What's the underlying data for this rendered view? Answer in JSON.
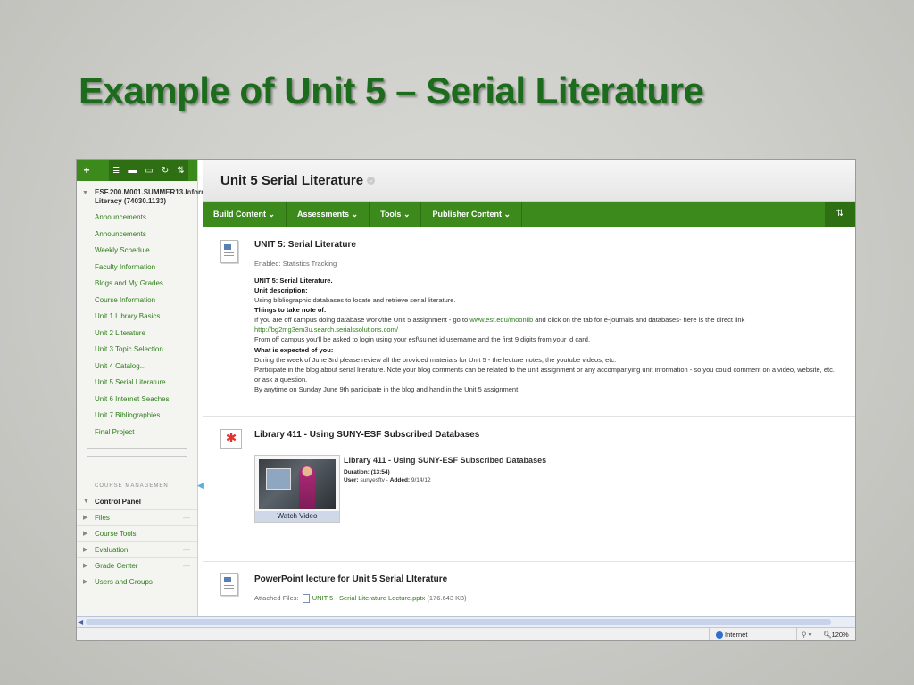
{
  "slide": {
    "title": "Example of Unit 5 – Serial Literature"
  },
  "sidebar": {
    "toolbar": {
      "add": "+",
      "icons": [
        "≣",
        "▬",
        "▭",
        "↻",
        "⇅"
      ]
    },
    "course_title": "ESF.200.M001.SUMMER13.Information Literacy (74030.1133)",
    "items": [
      "Announcements",
      "Announcements",
      "Weekly Schedule",
      "Faculty Information",
      "Blogs and My Grades",
      "Course Information",
      "Unit 1 Library Basics",
      "Unit 2 Literature",
      "Unit 3 Topic Selection",
      "Unit 4 Catalog...",
      "Unit 5 Serial Literature",
      "Unit 6 Internet Seaches",
      "Unit 7 Bibliographies",
      "Final Project"
    ],
    "course_management_label": "COURSE MANAGEMENT",
    "control_panel": {
      "title": "Control Panel",
      "items": [
        "Files",
        "Course Tools",
        "Evaluation",
        "Grade Center",
        "Users and Groups"
      ]
    }
  },
  "main": {
    "page_title": "Unit 5 Serial Literature",
    "action_bar": [
      "Build Content ⌄",
      "Assessments ⌄",
      "Tools ⌄",
      "Publisher Content ⌄"
    ],
    "sort_icon": "⇅",
    "item1": {
      "title": "UNIT 5: Serial Literature",
      "enabled": "Enabled:  Statistics Tracking",
      "heading": "UNIT 5: Serial Literature.",
      "unit_desc_label": "Unit description:",
      "unit_desc": "Using bibliographic databases to locate and retrieve serial literature.",
      "notes_label": "Things to take note of:",
      "note_pre": "If you are off campus doing database work/the Unit 5 assignment - go to ",
      "note_link": "www.esf.edu/moonlib",
      "note_post": " and click on the tab for e-journals and databases- here is the direct link",
      "direct_link": "http://bg2mg3em3u.search.serialssolutions.com/",
      "login_note": "From off campus you'll be asked to login using your esf\\su net id username and the first 9 digits from your id card.",
      "expected_label": "What is expected of you:",
      "expected1": "During the week of June 3rd please review all the provided materials for Unit 5 - the lecture notes, the youtube videos, etc.",
      "expected2": "Participate in the blog about serial literature. Note your blog comments can be related to the unit assignment or any accompanying unit information - so you could comment on a video, website, etc. or ask a question.",
      "expected3": "By anytime on Sunday June 9th participate in the blog and hand in the Unit 5 assignment."
    },
    "item2": {
      "title": "Library 411 - Using SUNY-ESF Subscribed Databases",
      "video_title": "Library 411 - Using SUNY-ESF Subscribed Databases",
      "duration_label": "Duration:",
      "duration": "(13:54)",
      "user_label": "User:",
      "user": "sunyesftv",
      "added_label": "Added:",
      "added": "9/14/12",
      "watch": "Watch Video"
    },
    "item3": {
      "title": "PowerPoint lecture for Unit 5 Serial LIterature",
      "attached_label": "Attached Files:",
      "file": "UNIT 5 - Serial Literature Lecture.pptx",
      "size": "(176.643 KB)"
    }
  },
  "statusbar": {
    "zone": "Internet",
    "zoom": "120%"
  }
}
